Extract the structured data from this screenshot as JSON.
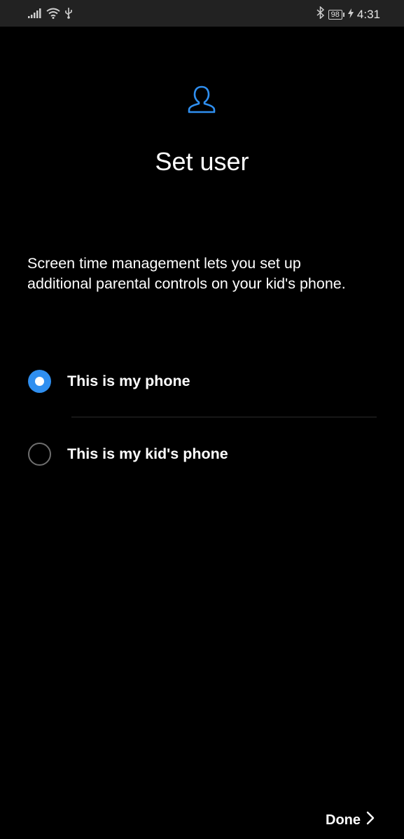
{
  "status_bar": {
    "battery_level": "98",
    "time": "4:31",
    "icons": [
      "signal-icon",
      "wifi-icon",
      "usb-icon",
      "bluetooth-icon",
      "battery-icon",
      "charging-icon"
    ]
  },
  "header": {
    "icon": "user-icon",
    "title": "Set user"
  },
  "description": "Screen time management lets you set up additional parental controls on your kid's phone.",
  "options": [
    {
      "label": "This is my phone",
      "selected": true
    },
    {
      "label": "This is my kid's phone",
      "selected": false
    }
  ],
  "footer": {
    "done_label": "Done",
    "icon": "chevron-right-icon"
  },
  "colors": {
    "accent": "#2f8ff0",
    "background": "#000000",
    "status_bar": "#222222"
  }
}
